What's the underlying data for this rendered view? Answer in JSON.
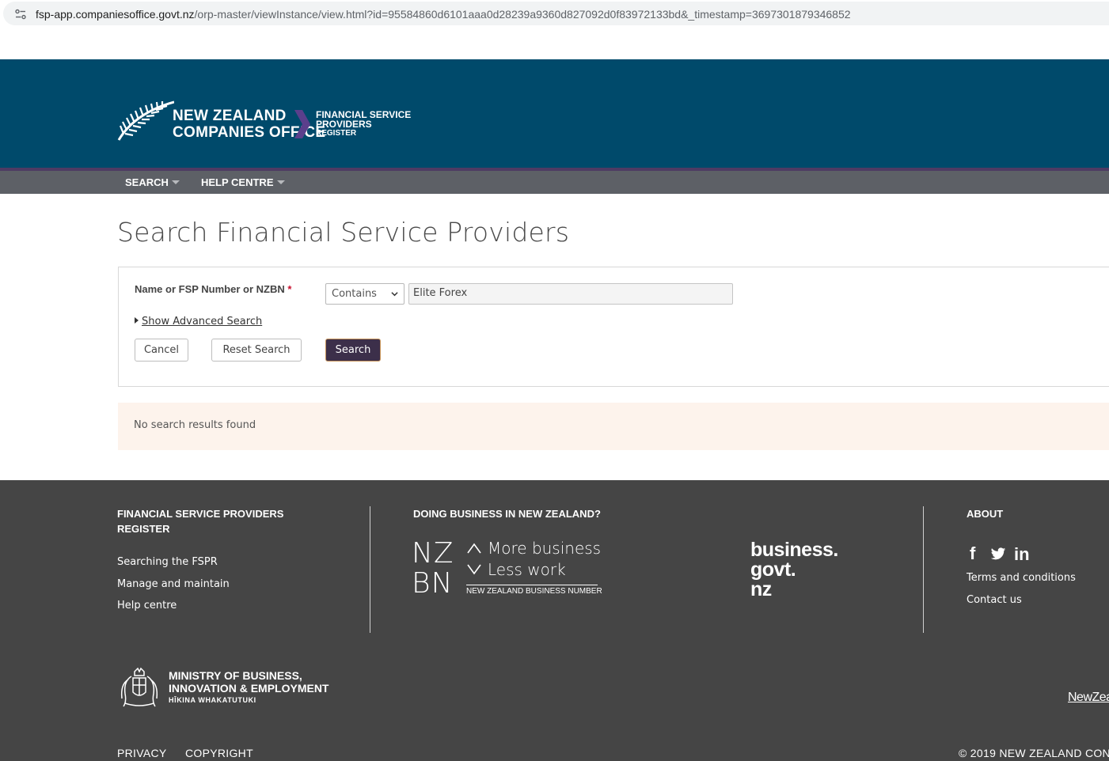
{
  "browser": {
    "url_host": "fsp-app.companiesoffice.govt.nz",
    "url_path": "/orp-master/viewInstance/view.html?id=95584860d6101aaa0d28239a9360d827092d0f83972133bd&_timestamp=3697301879346852"
  },
  "header": {
    "logo_line1": "NEW ZEALAND",
    "logo_line2": "COMPANIES OFFICE",
    "register_line1": "FINANCIAL SERVICE",
    "register_line2": "PROVIDERS",
    "register_line3": "REGISTER"
  },
  "nav": {
    "search": "SEARCH",
    "help_centre": "HELP CENTRE"
  },
  "page_title": "Search Financial Service Providers",
  "search_form": {
    "field_label": "Name or FSP Number or NZBN",
    "required_mark": "*",
    "match_select": "Contains",
    "query_value": "Elite Forex",
    "advanced_link": "Show Advanced Search",
    "cancel": "Cancel",
    "reset": "Reset Search",
    "search": "Search"
  },
  "results": {
    "message": "No search results found"
  },
  "footer": {
    "col1_heading_line1": "FINANCIAL SERVICE PROVIDERS",
    "col1_heading_line2": "REGISTER",
    "col1_links": [
      "Searching the FSPR",
      "Manage and maintain",
      "Help centre"
    ],
    "col2_heading": "DOING BUSINESS IN NEW ZEALAND?",
    "nzbn": {
      "line1": "NZ",
      "line2": "BN",
      "tag1": "More business",
      "tag2": "Less work",
      "subtitle": "NEW ZEALAND BUSINESS NUMBER"
    },
    "business_govt": {
      "line1": "business.",
      "line2": "govt.",
      "line3": "nz"
    },
    "col3_heading": "ABOUT",
    "social": {
      "facebook": "f",
      "linkedin": "in"
    },
    "col3_links": [
      "Terms and conditions",
      "Contact us"
    ],
    "mbie": {
      "line1": "MINISTRY OF BUSINESS,",
      "line2": "INNOVATION & EMPLOYMENT",
      "line3": "HĪKINA WHAKATUTUKI"
    },
    "nz_govt": "NewZea",
    "bottom_links": [
      "PRIVACY",
      "COPYRIGHT"
    ],
    "copyright": "© 2019 NEW ZEALAND CON"
  },
  "colors": {
    "header_bg": "#004a6b",
    "nav_bg": "#5d6066",
    "primary_button": "#3c2f4a",
    "footer_bg": "#454545",
    "results_bg": "#fdf3ec"
  }
}
